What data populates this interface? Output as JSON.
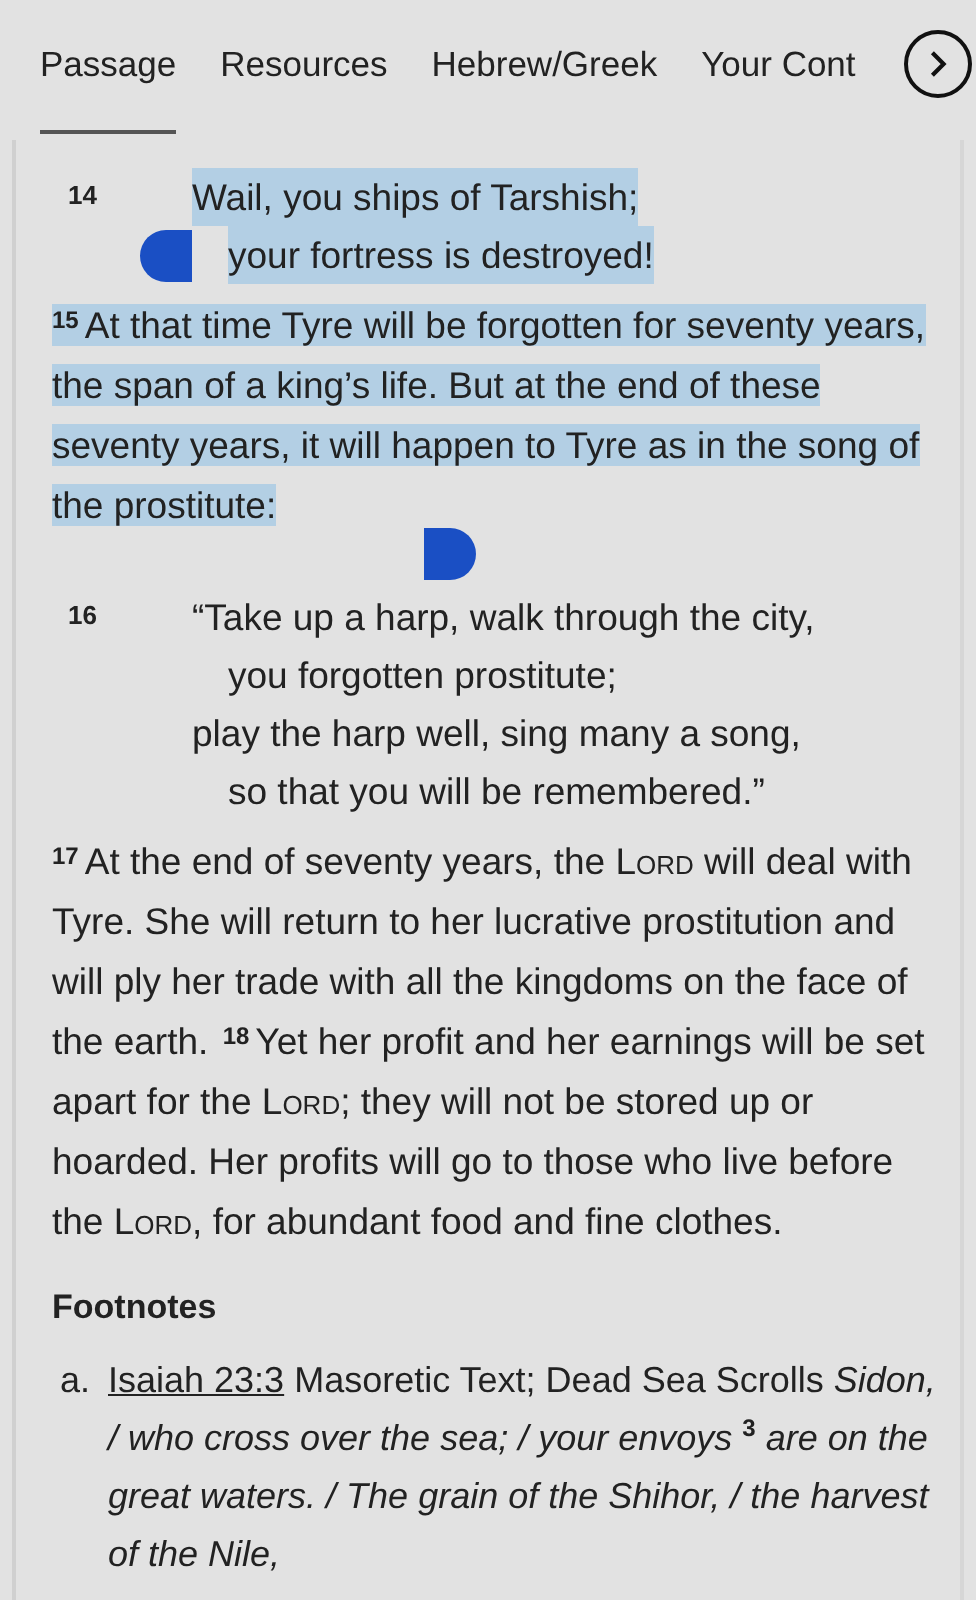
{
  "tabs": [
    {
      "label": "Passage",
      "selected": true
    },
    {
      "label": "Resources",
      "selected": false
    },
    {
      "label": "Hebrew/Greek",
      "selected": false
    },
    {
      "label": "Your Cont",
      "selected": false
    }
  ],
  "passage": [
    {
      "kind": "poetry",
      "verse": "14",
      "highlighted": true,
      "lines": [
        {
          "text": "Wail, you ships of Tarshish;",
          "kind": "line"
        },
        {
          "text": "your fortress is destroyed!",
          "kind": "indent"
        }
      ]
    },
    {
      "kind": "prose",
      "highlighted": true,
      "segments": [
        {
          "kind": "verse",
          "text": "15"
        },
        {
          "kind": "text",
          "text": "At that time Tyre will be forgotten for seventy years, the span of a king’s life. But at the end of these seventy years, it will happen to Tyre as in the song of the prostitute:"
        }
      ]
    },
    {
      "kind": "poetry",
      "verse": "16",
      "highlighted": false,
      "lines": [
        {
          "text": "“Take up a harp, walk through the city,",
          "kind": "line"
        },
        {
          "text": "you forgotten prostitute;",
          "kind": "indent"
        },
        {
          "text": "play the harp well, sing many a song,",
          "kind": "line"
        },
        {
          "text": "so that you will be remembered.”",
          "kind": "indent"
        }
      ]
    },
    {
      "kind": "prose",
      "highlighted": false,
      "segments": [
        {
          "kind": "verse",
          "text": "17"
        },
        {
          "kind": "text",
          "text": "At the end of seventy years, the "
        },
        {
          "kind": "smallcaps",
          "text": "Lord"
        },
        {
          "kind": "text",
          "text": " will deal with Tyre. She will return to her lucrative prostitution and will ply her trade with all the kingdoms on the face of the earth. "
        },
        {
          "kind": "verse",
          "text": "18"
        },
        {
          "kind": "text",
          "text": "Yet her profit and her earnings will be set apart for the "
        },
        {
          "kind": "smallcaps",
          "text": "Lord"
        },
        {
          "kind": "text",
          "text": "; they will not be stored up or hoarded. Her profits will go to those who live before the "
        },
        {
          "kind": "smallcaps",
          "text": "Lord"
        },
        {
          "kind": "text",
          "text": ", for abundant food and fine clothes."
        }
      ]
    }
  ],
  "footnotes": {
    "heading": "Footnotes",
    "items": [
      {
        "marker": "a.",
        "link": "Isaiah 23:3",
        "text": "Masoretic Text; Dead Sea Scrolls *Sidon, / who cross over the sea; / your envoys* $^{3}$ *are on the great waters. / The grain of the Shihor, / the harvest of the Nile,*"
      }
    ]
  }
}
